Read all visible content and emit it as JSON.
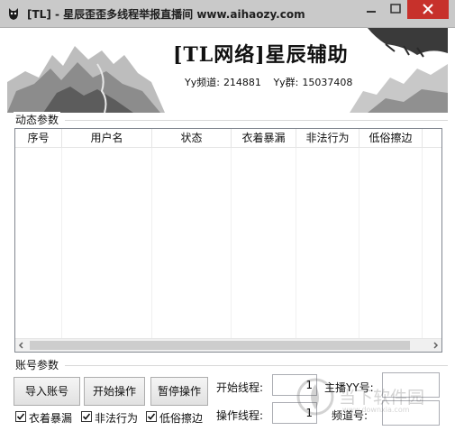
{
  "window": {
    "title": "[TL] - 星辰歪歪多线程举报直播间  www.aihaozy.com"
  },
  "banner": {
    "title": "[TL网络]星辰辅助",
    "yy_channel_label": "Yy频道:",
    "yy_channel_value": "214881",
    "yy_group_label": "Yy群:",
    "yy_group_value": "15037408"
  },
  "dynamic_group": {
    "label": "动态参数",
    "columns": [
      "序号",
      "用户名",
      "状态",
      "衣着暴漏",
      "非法行为",
      "低俗擦边"
    ],
    "rows": []
  },
  "account_group": {
    "label": "账号参数",
    "import_button": "导入账号",
    "start_button": "开始操作",
    "pause_button": "暂停操作",
    "start_thread_label": "开始线程:",
    "start_thread_value": "1",
    "op_thread_label": "操作线程:",
    "op_thread_value": "1",
    "anchor_yy_label": "主播YY号:",
    "anchor_yy_value": "",
    "channel_no_label": "频道号:",
    "channel_no_value": "",
    "checkboxes": [
      {
        "label": "衣着暴漏",
        "checked": true
      },
      {
        "label": "非法行为",
        "checked": true
      },
      {
        "label": "低俗擦边",
        "checked": true
      }
    ]
  },
  "watermark": {
    "text": "当下软件园",
    "url": "www.downxia.com"
  },
  "colors": {
    "titlebar": "#c9c9c9",
    "close_button": "#c7312b"
  }
}
